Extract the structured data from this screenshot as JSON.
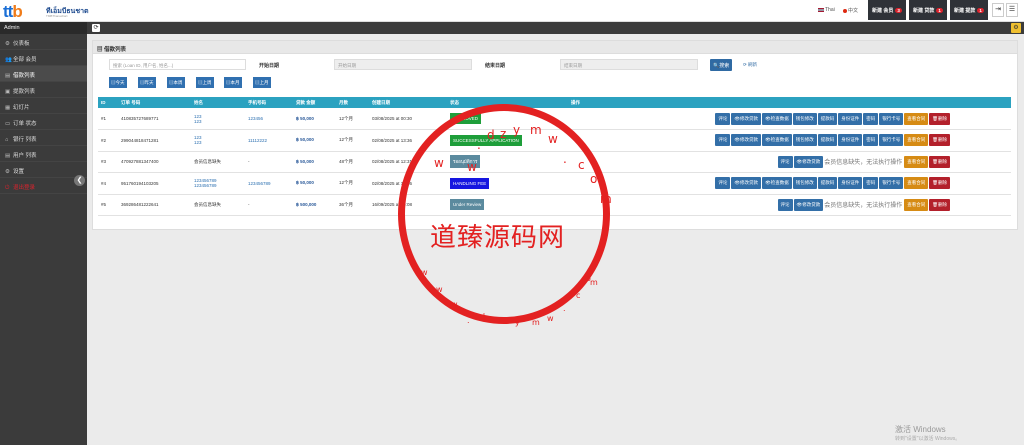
{
  "header": {
    "logo_mark_a": "tt",
    "logo_mark_b": "b",
    "logo_text": "ทีเอ็มบีธนชาต",
    "logo_sub": "TMBThanachart",
    "lang_th": "Thai",
    "lang_cn": "中文",
    "btn_member": "新建 会员",
    "btn_member_count": "3",
    "btn_loan": "新建 贷款",
    "btn_loan_count": "1",
    "btn_withdraw": "新建 提款",
    "btn_withdraw_count": "1",
    "icon_exit": "⇥",
    "icon_menu": "☰"
  },
  "sidebar": {
    "head": "Admin",
    "items": [
      {
        "icon": "⚙",
        "label": "仪表板"
      },
      {
        "icon": "👥",
        "label": "全部 会员"
      },
      {
        "icon": "▤",
        "label": "借款列表"
      },
      {
        "icon": "▣",
        "label": "提款列表"
      },
      {
        "icon": "▦",
        "label": "幻灯片"
      },
      {
        "icon": "▭",
        "label": "订单 状态"
      },
      {
        "icon": "⌂",
        "label": "银行 列表"
      },
      {
        "icon": "▤",
        "label": "用户 列表"
      },
      {
        "icon": "⚙",
        "label": "设置"
      },
      {
        "icon": "⏻",
        "label": "退出登录"
      }
    ]
  },
  "panel": {
    "title": "借款列表"
  },
  "filters": {
    "search_placeholder": "搜索 (Loan ID, 用户名, 姓名...)",
    "start_label": "开始日期",
    "start_placeholder": "开始日期",
    "end_label": "结束日期",
    "end_placeholder": "结束日期",
    "search_btn": "🔍搜索",
    "reset": "⟳ 刷新",
    "quick": [
      "▤今天",
      "▤昨天",
      "▤本周",
      "▤上周",
      "▤本月",
      "▤上月"
    ]
  },
  "table": {
    "headers": [
      "ID",
      "订单 号码",
      "姓名",
      "手机号码",
      "贷款 金额",
      "月数",
      "创建日期",
      "状态",
      "操作"
    ],
    "rows": [
      {
        "id": "#1",
        "order": "410835727689771",
        "name": "123",
        "name2": "123",
        "phone": "123456",
        "amount": "฿ 50,000",
        "months": "12个月",
        "date": "03/08/2025 at 00:30",
        "status": "APPROVED",
        "status_color": "#1e9e3a"
      },
      {
        "id": "#2",
        "order": "299044818471281",
        "name": "123",
        "name2": "123",
        "phone": "11112222",
        "amount": "฿ 50,000",
        "months": "12个月",
        "date": "02/08/2025 at 13:36",
        "status": "SUCCESSFULLY APPLICATION",
        "status_color": "#1e9e3a"
      },
      {
        "id": "#3",
        "order": "470927881347400",
        "name": "会员信息缺失",
        "name2": "",
        "phone": "-",
        "amount": "฿ 50,000",
        "months": "48个月",
        "date": "02/08/2025 at 12:31",
        "status": "รออนุมัติการ",
        "status_color": "#5b8a9e"
      },
      {
        "id": "#4",
        "order": "951760194103205",
        "name": "123456789",
        "name2": "123456789",
        "phone": "123456789",
        "amount": "฿ 50,000",
        "months": "12个月",
        "date": "02/08/2025 at 16:16",
        "status": "HANDLING FEE",
        "status_color": "#1616e0"
      },
      {
        "id": "#5",
        "order": "369286481222641",
        "name": "会员信息缺失",
        "name2": "",
        "phone": "-",
        "amount": "฿ 500,000",
        "months": "36个月",
        "date": "16/09/2025 at 20:08",
        "status": "Under Review",
        "status_color": "#5b8a9e"
      }
    ],
    "ops": {
      "comment": "评论",
      "edit_loan": "👁修改贷款",
      "view_data": "👁检查数据",
      "wallet": "钱包修改",
      "wallet_pwd": "提款码",
      "id_card": "身份证件",
      "password": "密码",
      "bank_card": "银行卡号",
      "contract": "查看合同",
      "delete": "🗑删除",
      "missing": "会员信息缺失，无法执行操作"
    }
  },
  "watermark": {
    "title": "道臻源码网",
    "top_chars": [
      "w",
      "w",
      ".",
      "d",
      "z",
      "y",
      "m",
      "w",
      ".",
      "c",
      "o",
      "m"
    ],
    "bottom_chars": [
      "w",
      "w",
      "w",
      ".",
      "d",
      "z",
      "y",
      "m",
      "w",
      ".",
      "c",
      "o",
      "m"
    ]
  },
  "windows": {
    "line1": "激活 Windows",
    "line2": "转到\"设置\"以激活 Windows。"
  }
}
